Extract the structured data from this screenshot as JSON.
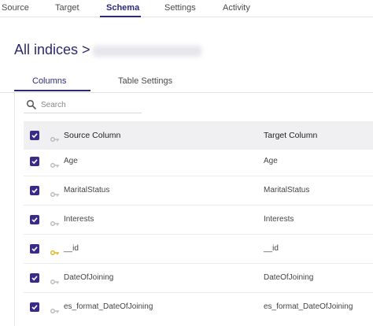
{
  "topnav": {
    "tabs": [
      {
        "label": "Source",
        "active": false
      },
      {
        "label": "Target",
        "active": false
      },
      {
        "label": "Schema",
        "active": true
      },
      {
        "label": "Settings",
        "active": false
      },
      {
        "label": "Activity",
        "active": false
      }
    ]
  },
  "page": {
    "title": "All indices >"
  },
  "subtabs": [
    {
      "label": "Columns",
      "active": true
    },
    {
      "label": "Table Settings",
      "active": false
    }
  ],
  "search": {
    "placeholder": "Search",
    "value": ""
  },
  "table": {
    "headers": {
      "source": "Source Column",
      "target": "Target Column"
    },
    "rows": [
      {
        "source": "Age",
        "target": "Age",
        "checked": true,
        "primary_key": false
      },
      {
        "source": "MaritalStatus",
        "target": "MaritalStatus",
        "checked": true,
        "primary_key": false
      },
      {
        "source": "Interests",
        "target": "Interests",
        "checked": true,
        "primary_key": false
      },
      {
        "source": "__id",
        "target": "__id",
        "checked": true,
        "primary_key": true
      },
      {
        "source": "DateOfJoining",
        "target": "DateOfJoining",
        "checked": true,
        "primary_key": false
      },
      {
        "source": "es_format_DateOfJoining",
        "target": "es_format_DateOfJoining",
        "checked": true,
        "primary_key": false
      }
    ]
  },
  "colors": {
    "accent": "#2b2b7a",
    "checkbox": "#3b2a8a",
    "key_inactive": "#b5b5bc",
    "key_primary": "#e0b21a"
  },
  "icons": {
    "search": "search-icon",
    "key": "key-icon",
    "checkbox": "checkbox-checked-icon"
  }
}
